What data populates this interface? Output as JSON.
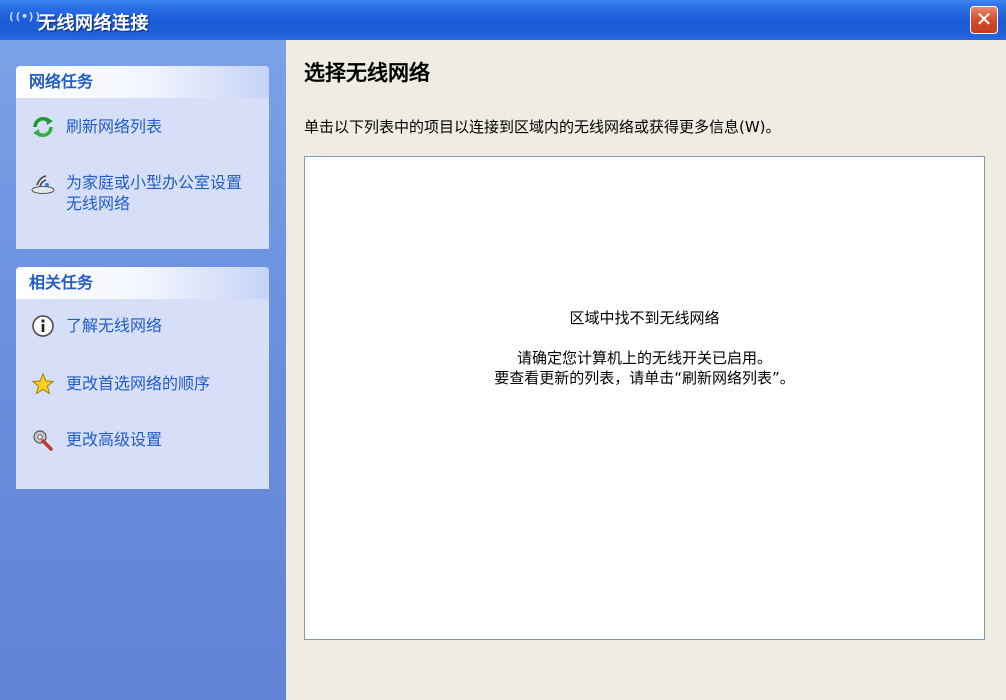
{
  "window": {
    "title": "无线网络连接",
    "title_icon": "((•))",
    "close_symbol": "✕"
  },
  "sidebar": {
    "network_tasks": {
      "header": "网络任务",
      "items": [
        {
          "label": "刷新网络列表",
          "icon": "refresh-icon"
        },
        {
          "label": "为家庭或小型办公室设置无线网络",
          "icon": "wireless-setup-icon"
        }
      ]
    },
    "related_tasks": {
      "header": "相关任务",
      "items": [
        {
          "label": "了解无线网络",
          "icon": "info-icon"
        },
        {
          "label": "更改首选网络的顺序",
          "icon": "star-icon"
        },
        {
          "label": "更改高级设置",
          "icon": "settings-icon"
        }
      ]
    }
  },
  "main": {
    "heading": "选择无线网络",
    "instruction": "单击以下列表中的项目以连接到区域内的无线网络或获得更多信息(W)。",
    "empty": {
      "title": "区域中找不到无线网络",
      "line1": "请确定您计算机上的无线开关已启用。",
      "line2": "要查看更新的列表，请单击“刷新网络列表”。"
    }
  },
  "colors": {
    "titlebar": "#1a5ad6",
    "sidebar": "#6c91e0",
    "panel_body": "#d6dff7",
    "link": "#215dc6",
    "close": "#d4502f"
  }
}
